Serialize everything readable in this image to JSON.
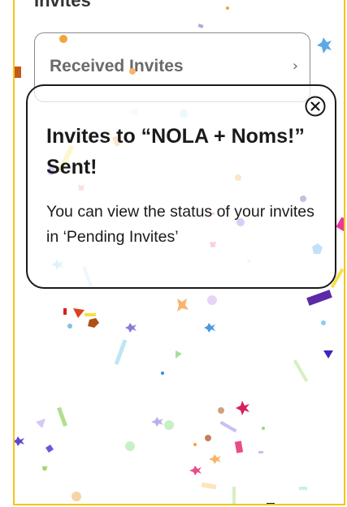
{
  "page": {
    "title": "Invites"
  },
  "received_invites": {
    "label": "Received Invites",
    "chevron": "›"
  },
  "modal": {
    "title": "Invites to “NOLA + Noms!” Sent!",
    "body": "You can view the status of your invites in ‘Pending Invites’",
    "close_icon": "close-circle-icon"
  },
  "colors": {
    "frame_border": "#F5C518",
    "modal_border": "#1a1a1a",
    "text": "#1a1a1a",
    "row_text": "#6a6a6a"
  }
}
